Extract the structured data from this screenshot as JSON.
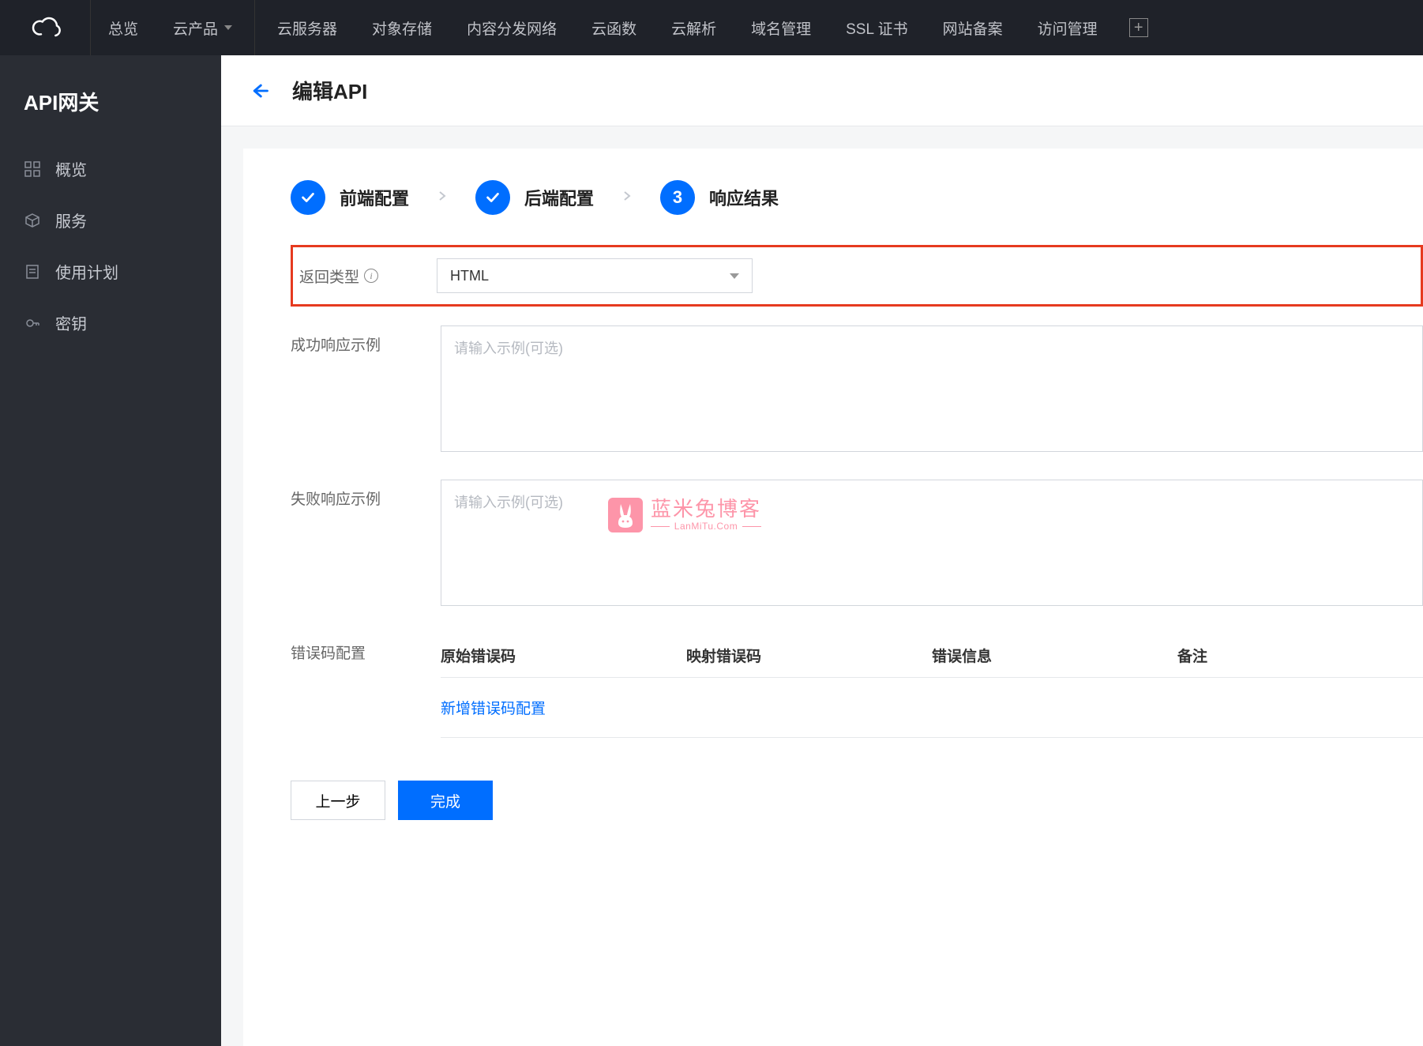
{
  "topbar": {
    "items": [
      {
        "label": "总览"
      },
      {
        "label": "云产品",
        "dropdown": true
      },
      {
        "label": "云服务器"
      },
      {
        "label": "对象存储"
      },
      {
        "label": "内容分发网络"
      },
      {
        "label": "云函数"
      },
      {
        "label": "云解析"
      },
      {
        "label": "域名管理"
      },
      {
        "label": "SSL 证书"
      },
      {
        "label": "网站备案"
      },
      {
        "label": "访问管理"
      }
    ]
  },
  "sidebar": {
    "title": "API网关",
    "items": [
      {
        "label": "概览",
        "icon": "grid"
      },
      {
        "label": "服务",
        "icon": "cube"
      },
      {
        "label": "使用计划",
        "icon": "doc"
      },
      {
        "label": "密钥",
        "icon": "key"
      }
    ]
  },
  "page": {
    "title": "编辑API"
  },
  "steps": [
    {
      "label": "前端配置",
      "state": "done"
    },
    {
      "label": "后端配置",
      "state": "done"
    },
    {
      "label": "响应结果",
      "state": "current",
      "num": "3"
    }
  ],
  "form": {
    "return_type": {
      "label": "返回类型",
      "value": "HTML"
    },
    "success_example": {
      "label": "成功响应示例",
      "placeholder": "请输入示例(可选)",
      "value": ""
    },
    "fail_example": {
      "label": "失败响应示例",
      "placeholder": "请输入示例(可选)",
      "value": ""
    },
    "error_codes": {
      "label": "错误码配置",
      "columns": [
        "原始错误码",
        "映射错误码",
        "错误信息",
        "备注"
      ],
      "add_link": "新增错误码配置"
    }
  },
  "buttons": {
    "prev": "上一步",
    "finish": "完成"
  },
  "watermark": {
    "title": "蓝米兔博客",
    "sub": "LanMiTu.Com"
  },
  "colors": {
    "primary": "#006eff",
    "highlight_border": "#e63a1f"
  }
}
